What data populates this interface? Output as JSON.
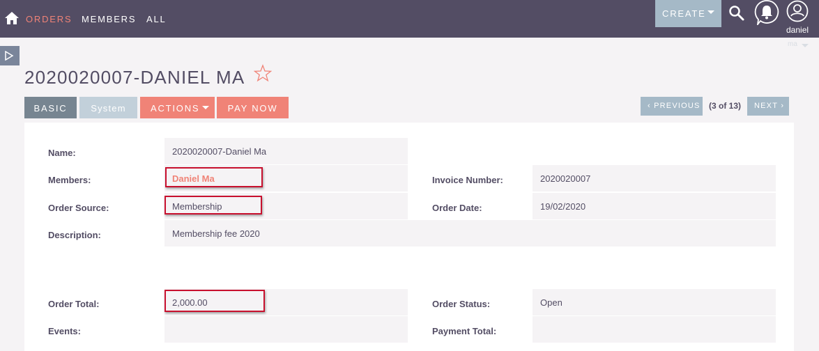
{
  "nav": {
    "items": [
      {
        "label": "ORDERS",
        "active": true
      },
      {
        "label": "MEMBERS"
      },
      {
        "label": "ALL"
      }
    ],
    "create_label": "CREATE",
    "username": "daniel",
    "user_sub": "ma"
  },
  "page": {
    "title": "2020020007-DANIEL MA"
  },
  "tabs": {
    "basic": "BASIC",
    "system": "System",
    "actions": "ACTIONS",
    "pay_now": "PAY NOW"
  },
  "pager": {
    "previous": "PREVIOUS",
    "count": "(3 of 13)",
    "next": "NEXT"
  },
  "detail": {
    "name_label": "Name:",
    "name_value": "2020020007-Daniel Ma",
    "members_label": "Members:",
    "members_value": "Daniel Ma",
    "invoice_label": "Invoice Number:",
    "invoice_value": "2020020007",
    "source_label": "Order Source:",
    "source_value": "Membership",
    "date_label": "Order Date:",
    "date_value": "19/02/2020",
    "description_label": "Description:",
    "description_value": "Membership fee 2020",
    "total_label": "Order Total:",
    "total_value": "2,000.00",
    "status_label": "Order Status:",
    "status_value": "Open",
    "events_label": "Events:",
    "events_value": "",
    "payment_label": "Payment Total:",
    "payment_value": ""
  },
  "colors": {
    "topbar": "#534d64",
    "accent": "#f08377",
    "button": "#a5b9c7",
    "highlight": "#c8102e"
  },
  "icons": [
    "home-icon",
    "search-icon",
    "notification-bell-icon",
    "user-avatar-icon",
    "caret-down-icon",
    "sidebar-toggle-icon",
    "star-icon",
    "chevron-left-icon",
    "chevron-right-icon"
  ]
}
